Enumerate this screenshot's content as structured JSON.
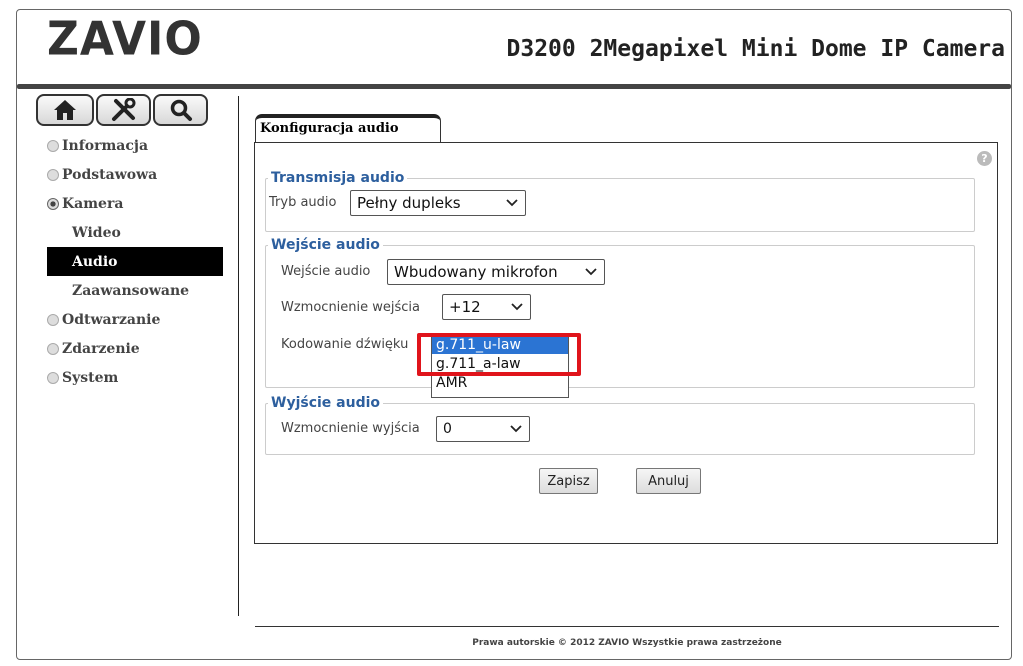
{
  "header": {
    "logo_text": "ZAVIO",
    "camera_title": "D3200 2Megapixel Mini Dome IP Camera"
  },
  "toolbar": {
    "icons": [
      "home-icon",
      "tools-icon",
      "search-icon"
    ]
  },
  "sidebar": {
    "items": [
      {
        "label": "Informacja"
      },
      {
        "label": "Podstawowa"
      },
      {
        "label": "Kamera",
        "expanded": true
      },
      {
        "label": "Odtwarzanie"
      },
      {
        "label": "Zdarzenie"
      },
      {
        "label": "System"
      }
    ],
    "sub_items": [
      {
        "label": "Wideo"
      },
      {
        "label": "Audio",
        "active": true
      },
      {
        "label": "Zaawansowane"
      }
    ]
  },
  "tab": {
    "label": "Konfiguracja audio"
  },
  "transmission": {
    "legend": "Transmisja audio",
    "mode_label": "Tryb audio",
    "mode_value": "Pełny dupleks"
  },
  "input": {
    "legend": "Wejście audio",
    "source_label": "Wejście audio",
    "source_value": "Wbudowany mikrofon",
    "gain_label": "Wzmocnienie wejścia",
    "gain_value": "+12",
    "codec_label": "Kodowanie dźwięku",
    "codec_options": [
      "g.711_u-law",
      "g.711_a-law",
      "AMR"
    ],
    "codec_selected": "g.711_u-law"
  },
  "output": {
    "legend": "Wyjście audio",
    "gain_label": "Wzmocnienie wyjścia",
    "gain_value": "0"
  },
  "actions": {
    "save_label": "Zapisz",
    "cancel_label": "Anuluj"
  },
  "footer": {
    "copyright": "Prawa autorskie © 2012 ZAVIO Wszystkie prawa zastrzeżone"
  },
  "colors": {
    "legend": "#2d5f9e",
    "selected_option": "#2b74d3",
    "highlight_box": "#e0141b",
    "active_nav": "#000000"
  }
}
